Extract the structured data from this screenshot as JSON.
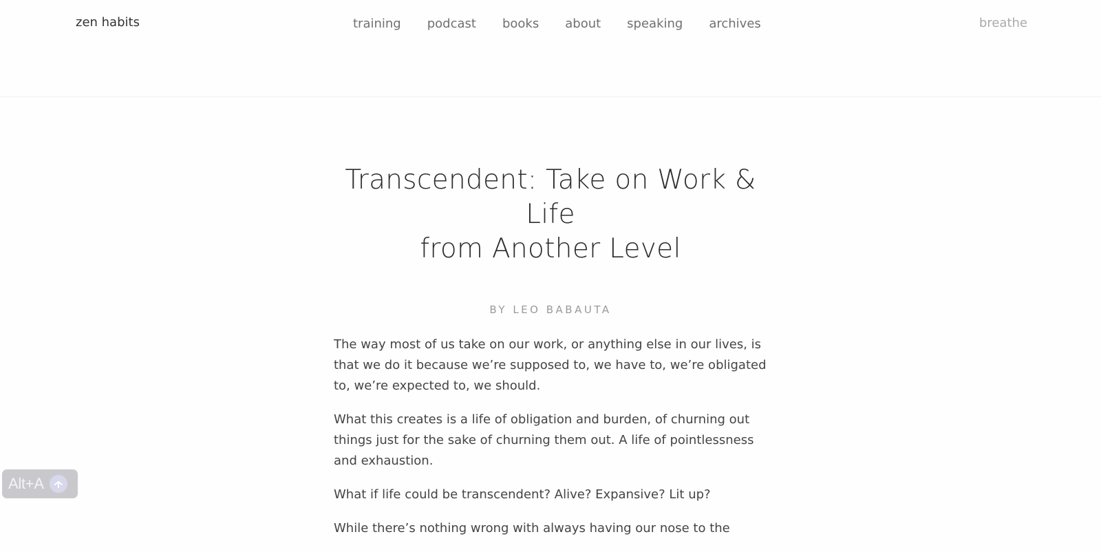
{
  "header": {
    "logo": "zen habits",
    "nav": [
      "training",
      "podcast",
      "books",
      "about",
      "speaking",
      "archives"
    ],
    "right_link": "breathe"
  },
  "article": {
    "title_line1": "Transcendent: Take on Work & Life",
    "title_line2": "from Another Level",
    "byline": "BY LEO BABAUTA",
    "paragraphs": [
      "The way most of us take on our work, or anything else in our lives, is that we do it because we’re supposed to, we have to, we’re obligated to, we’re expected to, we should.",
      "What this creates is a life of obligation and burden, of churning out things just for the sake of churning them out. A life of pointlessness and exhaustion.",
      "What if life could be transcendent? Alive? Expansive? Lit up?",
      "While there’s nothing wrong with always having our nose to the"
    ]
  },
  "overlay": {
    "shortcut_label": "Alt+A",
    "shortcut_icon": "arrow-icon"
  }
}
